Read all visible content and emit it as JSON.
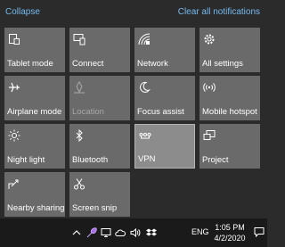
{
  "header": {
    "collapse_label": "Collapse",
    "clear_label": "Clear all notifications"
  },
  "tiles": [
    {
      "label": "Tablet mode",
      "icon": "tablet-mode-icon",
      "state": "normal"
    },
    {
      "label": "Connect",
      "icon": "connect-icon",
      "state": "normal"
    },
    {
      "label": "Network",
      "icon": "network-icon",
      "state": "normal"
    },
    {
      "label": "All settings",
      "icon": "gear-icon",
      "state": "normal"
    },
    {
      "label": "Airplane mode",
      "icon": "airplane-icon",
      "state": "normal"
    },
    {
      "label": "Location",
      "icon": "location-icon",
      "state": "disabled"
    },
    {
      "label": "Focus assist",
      "icon": "moon-icon",
      "state": "normal"
    },
    {
      "label": "Mobile hotspot",
      "icon": "hotspot-icon",
      "state": "normal"
    },
    {
      "label": "Night light",
      "icon": "sun-icon",
      "state": "normal"
    },
    {
      "label": "Bluetooth",
      "icon": "bluetooth-icon",
      "state": "normal"
    },
    {
      "label": "VPN",
      "icon": "vpn-icon",
      "state": "active"
    },
    {
      "label": "Project",
      "icon": "project-icon",
      "state": "normal"
    },
    {
      "label": "Nearby sharing",
      "icon": "nearby-sharing-icon",
      "state": "normal"
    },
    {
      "label": "Screen snip",
      "icon": "screen-snip-icon",
      "state": "normal"
    }
  ],
  "taskbar": {
    "language": "ENG",
    "time": "1:05 PM",
    "date": "4/2/2020",
    "tray_icons": [
      "chevron-up-icon",
      "feather-icon",
      "monitor-icon",
      "cloud-icon",
      "speaker-icon",
      "dropbox-icon"
    ]
  },
  "colors": {
    "accent_link": "#76b9ed",
    "tile_bg": "#6a6a6a",
    "tile_active_bg": "#8c8c8c",
    "panel_bg": "#2b2b2b",
    "taskbar_bg": "#1a1a1a"
  }
}
